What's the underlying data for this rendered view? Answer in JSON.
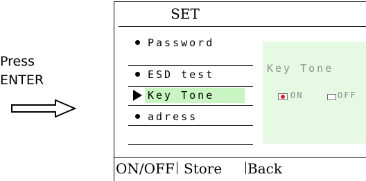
{
  "instruction": {
    "line1": "Press",
    "line2": "ENTER"
  },
  "screen": {
    "title": "SET",
    "menu": [
      {
        "label": "Password"
      },
      {
        "label": "ESD test"
      },
      {
        "label": "Key Tone",
        "selected": true
      },
      {
        "label": "adress"
      }
    ],
    "panel": {
      "title": "Key Tone",
      "options": [
        {
          "label": "ON",
          "checked": true
        },
        {
          "label": "OFF",
          "checked": false
        }
      ]
    },
    "footer": {
      "onoff_label": "ON/OFF",
      "store_label": "Store",
      "back_label": "Back"
    }
  },
  "colors": {
    "selected_highlight": "#c9f5c2",
    "panel_background": "#e6f9e3",
    "checked_indicator": "#e02020"
  },
  "icons": {
    "arrow": "right-arrow-outline-icon",
    "pointer": "triangle-pointer-icon",
    "bullet": "bullet-dot-icon"
  }
}
